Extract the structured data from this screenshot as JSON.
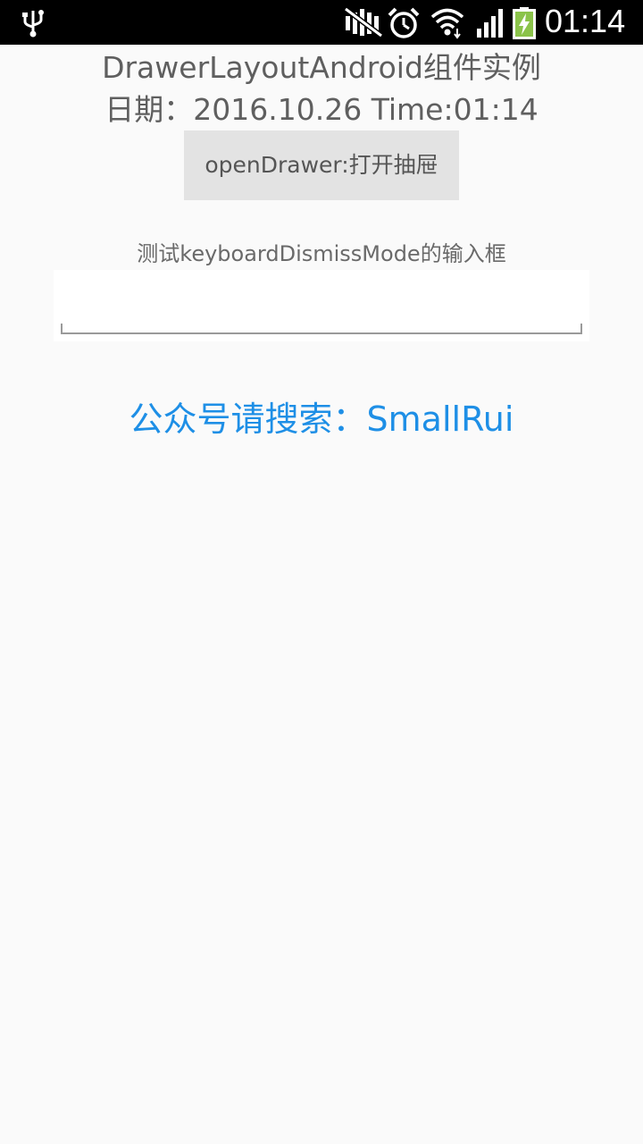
{
  "status_bar": {
    "time": "01:14",
    "icons": [
      "usb-icon",
      "mute-icon",
      "alarm-icon",
      "wifi-icon",
      "signal-icon",
      "battery-charging-icon"
    ]
  },
  "header": {
    "title": "DrawerLayoutAndroid组件实例",
    "date_line": "日期：2016.10.26 Time:01:14"
  },
  "main": {
    "open_drawer_label": "openDrawer:打开抽屉",
    "input_label": "测试keyboardDismissMode的输入框",
    "input_value": "",
    "input_placeholder": "",
    "promo_text": "公众号请搜索：SmallRui"
  },
  "colors": {
    "background": "#fafafa",
    "status_bar": "#000000",
    "text_gray": "#5f5f5f",
    "button_bg": "#e3e3e3",
    "promo_blue": "#1e8fe6",
    "battery_green": "#8bc34a"
  }
}
